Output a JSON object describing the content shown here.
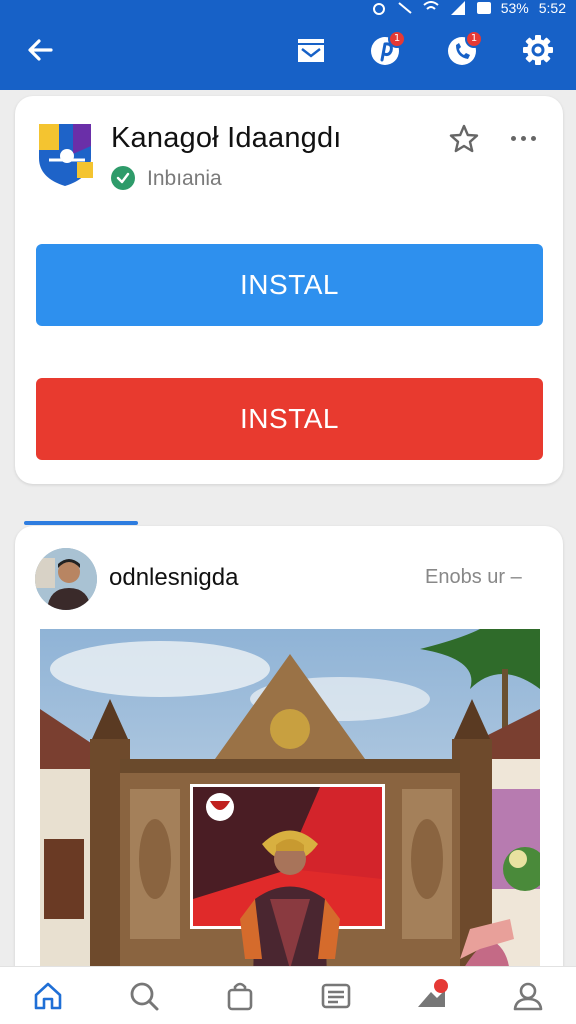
{
  "colors": {
    "topbar": "#1761c7",
    "primary_button": "#2e90ee",
    "danger_button": "#e83a2f",
    "verified": "#2e9b6a",
    "badge": "#e53935",
    "active_nav": "#1f6fd6"
  },
  "statusbar": {
    "battery": "53%",
    "time": "5:52"
  },
  "topbar": {
    "icons": [
      "back-arrow-icon",
      "inbox-icon",
      "pinterest-icon",
      "phone-icon",
      "settings-icon"
    ],
    "badge_1": "1",
    "badge_2": "1"
  },
  "app": {
    "title": "Kanagoł Idaangdı",
    "country": "Inbıania",
    "install_label_1": "INSTAL",
    "install_label_2": "INSTAL"
  },
  "post": {
    "username": "odnlesnigda",
    "meta": "Enobs ur –"
  },
  "bottom_nav": {
    "items": [
      "home-icon",
      "search-icon",
      "bag-icon",
      "feed-icon",
      "alert-icon",
      "profile-icon"
    ],
    "active": "home-icon"
  }
}
